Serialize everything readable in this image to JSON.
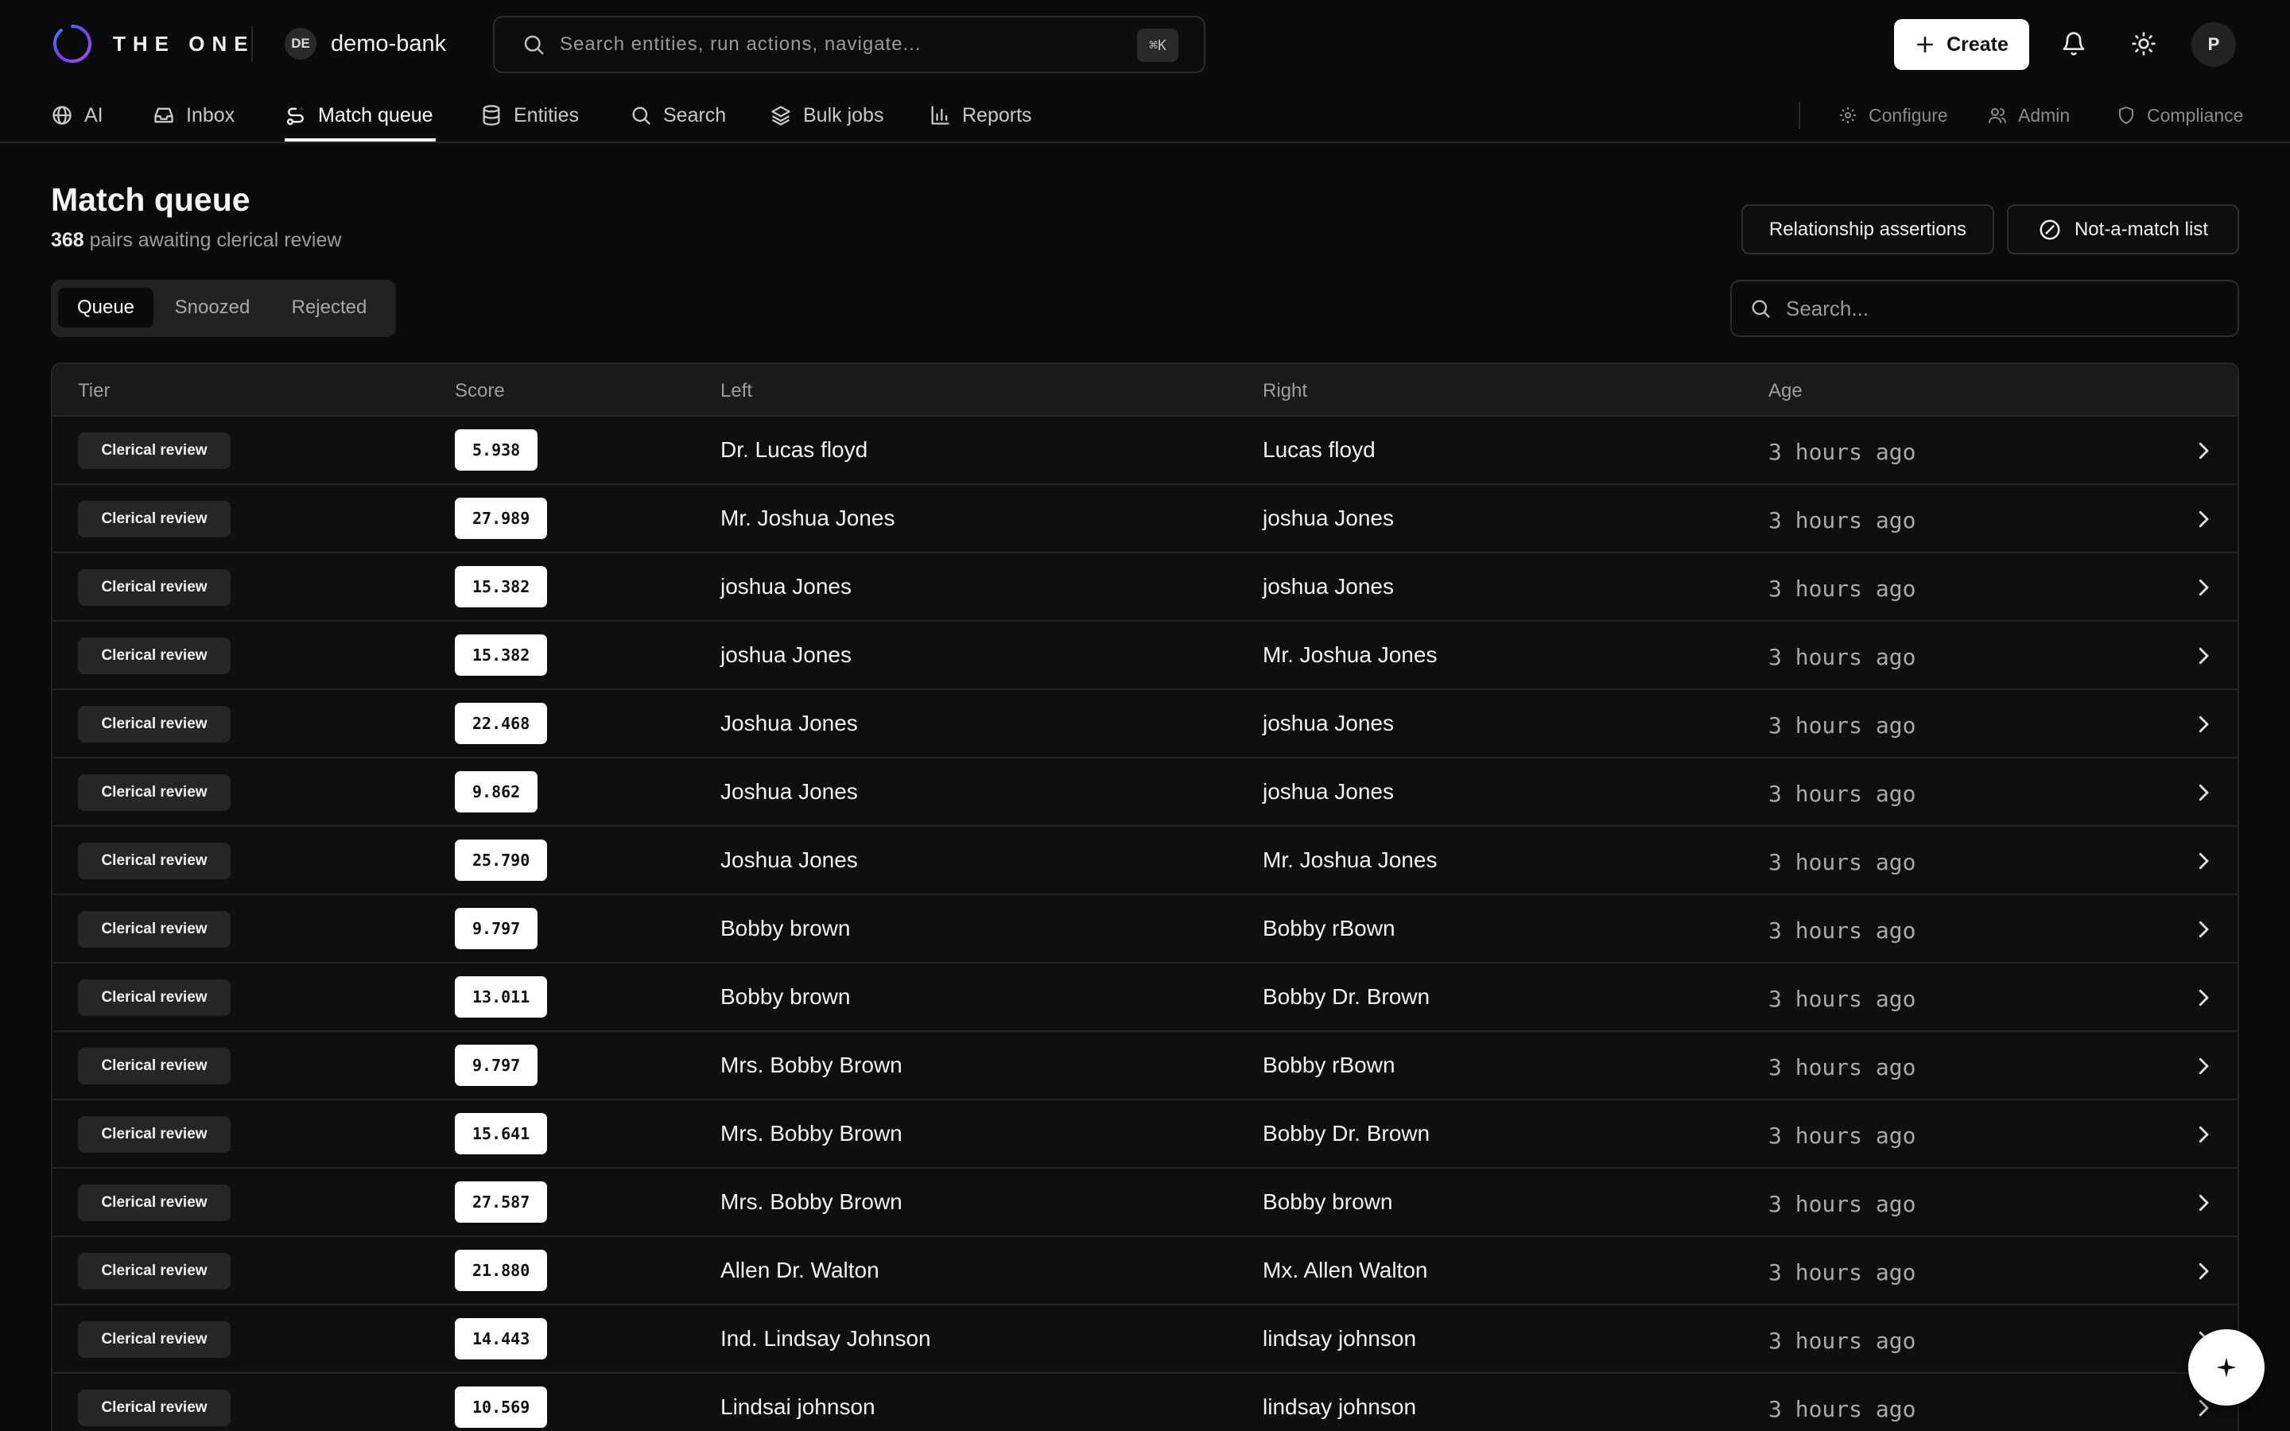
{
  "brand": {
    "name": "THE ONE"
  },
  "workspace": {
    "initials": "DE",
    "name": "demo-bank"
  },
  "command_search": {
    "placeholder": "Search entities, run actions, navigate...",
    "shortcut": "⌘K"
  },
  "header_actions": {
    "create_label": "Create",
    "user_initial": "P"
  },
  "nav": {
    "items": [
      {
        "label": "AI",
        "icon": "globe-icon"
      },
      {
        "label": "Inbox",
        "icon": "inbox-icon"
      },
      {
        "label": "Match queue",
        "icon": "route-icon",
        "active": true
      },
      {
        "label": "Entities",
        "icon": "database-icon"
      },
      {
        "label": "Search",
        "icon": "search-icon"
      },
      {
        "label": "Bulk jobs",
        "icon": "layers-icon"
      },
      {
        "label": "Reports",
        "icon": "bar-chart-icon"
      }
    ],
    "secondary": [
      {
        "label": "Configure",
        "icon": "gear-icon"
      },
      {
        "label": "Admin",
        "icon": "users-icon"
      },
      {
        "label": "Compliance",
        "icon": "shield-icon"
      }
    ]
  },
  "page": {
    "title": "Match queue",
    "count": "368",
    "subtitle_rest": " pairs awaiting clerical review",
    "relationship_button": "Relationship assertions",
    "not_match_button": "Not-a-match list"
  },
  "tabs": [
    {
      "label": "Queue",
      "active": true
    },
    {
      "label": "Snoozed"
    },
    {
      "label": "Rejected"
    }
  ],
  "filter_search": {
    "placeholder": "Search..."
  },
  "table": {
    "columns": [
      "Tier",
      "Score",
      "Left",
      "Right",
      "Age"
    ],
    "rows": [
      {
        "tier": "Clerical review",
        "score": "5.938",
        "left": "Dr. Lucas floyd",
        "right": "Lucas floyd",
        "age": "3 hours ago"
      },
      {
        "tier": "Clerical review",
        "score": "27.989",
        "left": "Mr. Joshua Jones",
        "right": "joshua Jones",
        "age": "3 hours ago"
      },
      {
        "tier": "Clerical review",
        "score": "15.382",
        "left": "joshua Jones",
        "right": "joshua Jones",
        "age": "3 hours ago"
      },
      {
        "tier": "Clerical review",
        "score": "15.382",
        "left": "joshua Jones",
        "right": "Mr. Joshua Jones",
        "age": "3 hours ago"
      },
      {
        "tier": "Clerical review",
        "score": "22.468",
        "left": "Joshua Jones",
        "right": "joshua Jones",
        "age": "3 hours ago"
      },
      {
        "tier": "Clerical review",
        "score": "9.862",
        "left": "Joshua Jones",
        "right": "joshua Jones",
        "age": "3 hours ago"
      },
      {
        "tier": "Clerical review",
        "score": "25.790",
        "left": "Joshua Jones",
        "right": "Mr. Joshua Jones",
        "age": "3 hours ago"
      },
      {
        "tier": "Clerical review",
        "score": "9.797",
        "left": "Bobby brown",
        "right": "Bobby rBown",
        "age": "3 hours ago"
      },
      {
        "tier": "Clerical review",
        "score": "13.011",
        "left": "Bobby brown",
        "right": "Bobby Dr. Brown",
        "age": "3 hours ago"
      },
      {
        "tier": "Clerical review",
        "score": "9.797",
        "left": "Mrs. Bobby Brown",
        "right": "Bobby rBown",
        "age": "3 hours ago"
      },
      {
        "tier": "Clerical review",
        "score": "15.641",
        "left": "Mrs. Bobby Brown",
        "right": "Bobby Dr. Brown",
        "age": "3 hours ago"
      },
      {
        "tier": "Clerical review",
        "score": "27.587",
        "left": "Mrs. Bobby Brown",
        "right": "Bobby brown",
        "age": "3 hours ago"
      },
      {
        "tier": "Clerical review",
        "score": "21.880",
        "left": "Allen Dr. Walton",
        "right": "Mx. Allen Walton",
        "age": "3 hours ago"
      },
      {
        "tier": "Clerical review",
        "score": "14.443",
        "left": "Ind. Lindsay Johnson",
        "right": "lindsay johnson",
        "age": "3 hours ago"
      },
      {
        "tier": "Clerical review",
        "score": "10.569",
        "left": "Lindsai johnson",
        "right": "lindsay johnson",
        "age": "3 hours ago"
      }
    ]
  },
  "colors": {
    "background": "#0b0b0b",
    "surface": "#0f0f0f",
    "border": "#262626",
    "text": "#ededed",
    "muted": "#9e9e9e",
    "brand_ring_start": "#3b82f6",
    "brand_ring_end": "#a855f7"
  }
}
